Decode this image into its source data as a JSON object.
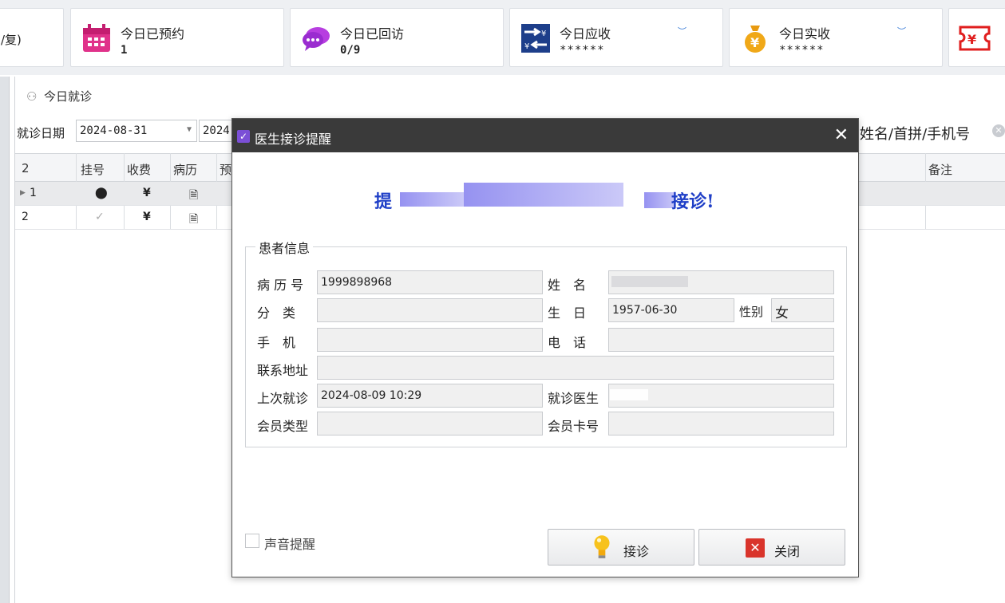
{
  "colors": {
    "accent_purple": "#7b4fd6",
    "headline_blue": "#1f3fc7",
    "titlebar": "#3a3a3a"
  },
  "stats": {
    "first_partial": "/复)",
    "booked_title": "今日已预约",
    "booked_value": "1",
    "revisit_title": "今日已回访",
    "revisit_value": "0/9",
    "receivable_title": "今日应收",
    "receivable_value": "******",
    "received_title": "今日实收",
    "received_value": "******"
  },
  "panel": {
    "title": "今日就诊",
    "date_label": "就诊日期",
    "date_from": "2024-08-31",
    "date_to_partial": "2024-",
    "search_placeholder": "姓名/首拼/手机号"
  },
  "grid": {
    "headers": [
      "2",
      "挂号",
      "收费",
      "病历",
      "预",
      "备注"
    ],
    "rows": [
      {
        "id": "1",
        "reg_icon": "location-pin-icon",
        "fee": "¥",
        "record_icon": "record-icon"
      },
      {
        "id": "2",
        "reg_icon": "check-icon",
        "fee": "¥",
        "record_icon": "record-icon"
      }
    ]
  },
  "dialog": {
    "title": "医生接诊提醒",
    "headline_start": "提",
    "headline_end": "接诊!",
    "group_title": "患者信息",
    "fields": {
      "record_no_label": "病 历 号",
      "record_no": "1999898968",
      "name_label": "姓　名",
      "name": "",
      "category_label": "分　类",
      "category": "",
      "birthday_label": "生　日",
      "birthday": "1957-06-30",
      "gender_label": "性别",
      "gender": "女",
      "mobile_label": "手　机",
      "mobile": "",
      "phone_label": "电　话",
      "phone": "",
      "address_label": "联系地址",
      "address": "",
      "last_visit_label": "上次就诊",
      "last_visit": "2024-08-09 10:29",
      "doctor_label": "就诊医生",
      "doctor": "",
      "member_type_label": "会员类型",
      "member_type": "",
      "member_card_label": "会员卡号",
      "member_card": ""
    },
    "sound_label": "声音提醒",
    "accept_button": "接诊",
    "close_button": "关闭"
  }
}
